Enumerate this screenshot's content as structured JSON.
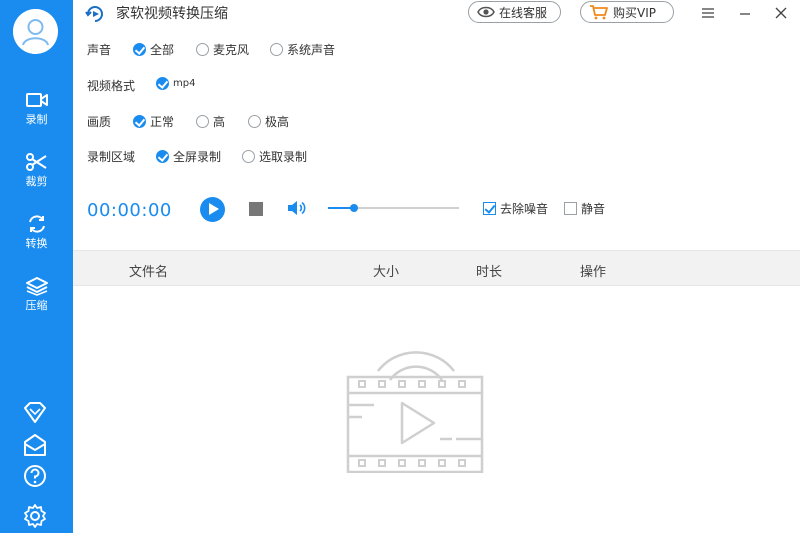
{
  "app": {
    "title": "家软视频转换压缩",
    "service_label": "在线客服",
    "vip_label": "购买VIP"
  },
  "sidebar": {
    "items": [
      {
        "label": "录制",
        "icon": "video-camera-icon"
      },
      {
        "label": "裁剪",
        "icon": "scissors-icon"
      },
      {
        "label": "转换",
        "icon": "convert-icon"
      },
      {
        "label": "压缩",
        "icon": "layers-icon"
      }
    ],
    "bottom_icons": [
      "vip-diamond-icon",
      "mail-icon",
      "help-icon",
      "settings-icon"
    ]
  },
  "settings": {
    "audio": {
      "label": "声音",
      "options": [
        "全部",
        "麦克风",
        "系统声音"
      ],
      "selected": "全部"
    },
    "format": {
      "label": "视频格式",
      "options": [
        "mp4"
      ],
      "selected": "mp4"
    },
    "quality": {
      "label": "画质",
      "options": [
        "正常",
        "高",
        "极高"
      ],
      "selected": "正常"
    },
    "region": {
      "label": "录制区域",
      "options": [
        "全屏录制",
        "选取录制"
      ],
      "selected": "全屏录制"
    }
  },
  "controls": {
    "timer": "00:00:00",
    "volume": 0.2,
    "noise_reduction": {
      "label": "去除噪音",
      "checked": true
    },
    "mute": {
      "label": "静音",
      "checked": false
    }
  },
  "table": {
    "columns": [
      "文件名",
      "大小",
      "时长",
      "操作"
    ],
    "rows": []
  },
  "colors": {
    "accent": "#1a8cf0",
    "sidebar_bg": "#1a8cf0",
    "header_bg": "#f2f2f2"
  }
}
